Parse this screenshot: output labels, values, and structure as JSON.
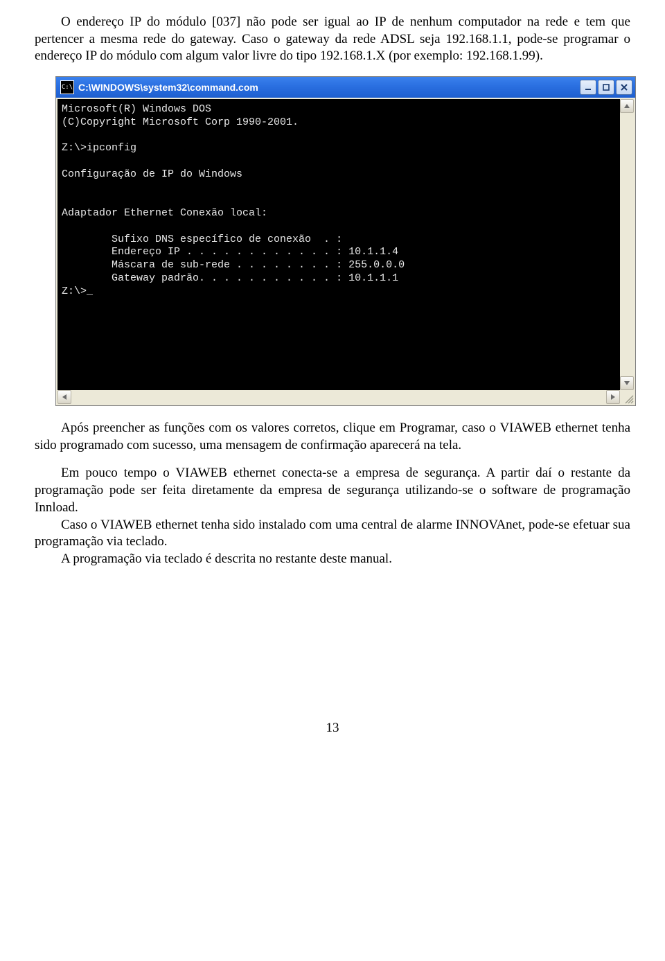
{
  "paragraphs": {
    "p1": "O endereço IP do módulo [037] não pode ser igual ao IP de nenhum computador na rede e tem que pertencer a mesma rede do gateway. Caso o gateway da rede ADSL seja 192.168.1.1, pode-se programar o endereço IP do módulo com algum valor livre do tipo 192.168.1.X (por exemplo: 192.168.1.99).",
    "p2": "Após preencher as funções com os valores corretos, clique em Programar, caso o VIAWEB ethernet tenha sido programado com sucesso, uma mensagem de confirmação aparecerá na tela.",
    "p3": "Em pouco tempo o VIAWEB ethernet conecta-se a empresa de segurança. A partir daí o restante da programação pode ser feita diretamente da empresa de segurança utilizando-se o software de programação Innload.",
    "p4": "Caso o VIAWEB ethernet tenha sido instalado com uma central de alarme INNOVAnet, pode-se efetuar sua programação via teclado.",
    "p5": "A programação via teclado é descrita no restante deste manual."
  },
  "cmd": {
    "title_icon": "C:\\",
    "title": "C:\\WINDOWS\\system32\\command.com",
    "lines": {
      "l0": "Microsoft(R) Windows DOS",
      "l1": "(C)Copyright Microsoft Corp 1990-2001.",
      "l2": "",
      "l3": "Z:\\>ipconfig",
      "l4": "",
      "l5": "Configuração de IP do Windows",
      "l6": "",
      "l7": "",
      "l8": "Adaptador Ethernet Conexão local:",
      "l9": "",
      "l10": "        Sufixo DNS específico de conexão  . :",
      "l11": "        Endereço IP . . . . . . . . . . . . : 10.1.1.4",
      "l12": "        Máscara de sub-rede . . . . . . . . : 255.0.0.0",
      "l13": "        Gateway padrão. . . . . . . . . . . : 10.1.1.1",
      "l14": "Z:\\>_"
    }
  },
  "page_number": "13"
}
